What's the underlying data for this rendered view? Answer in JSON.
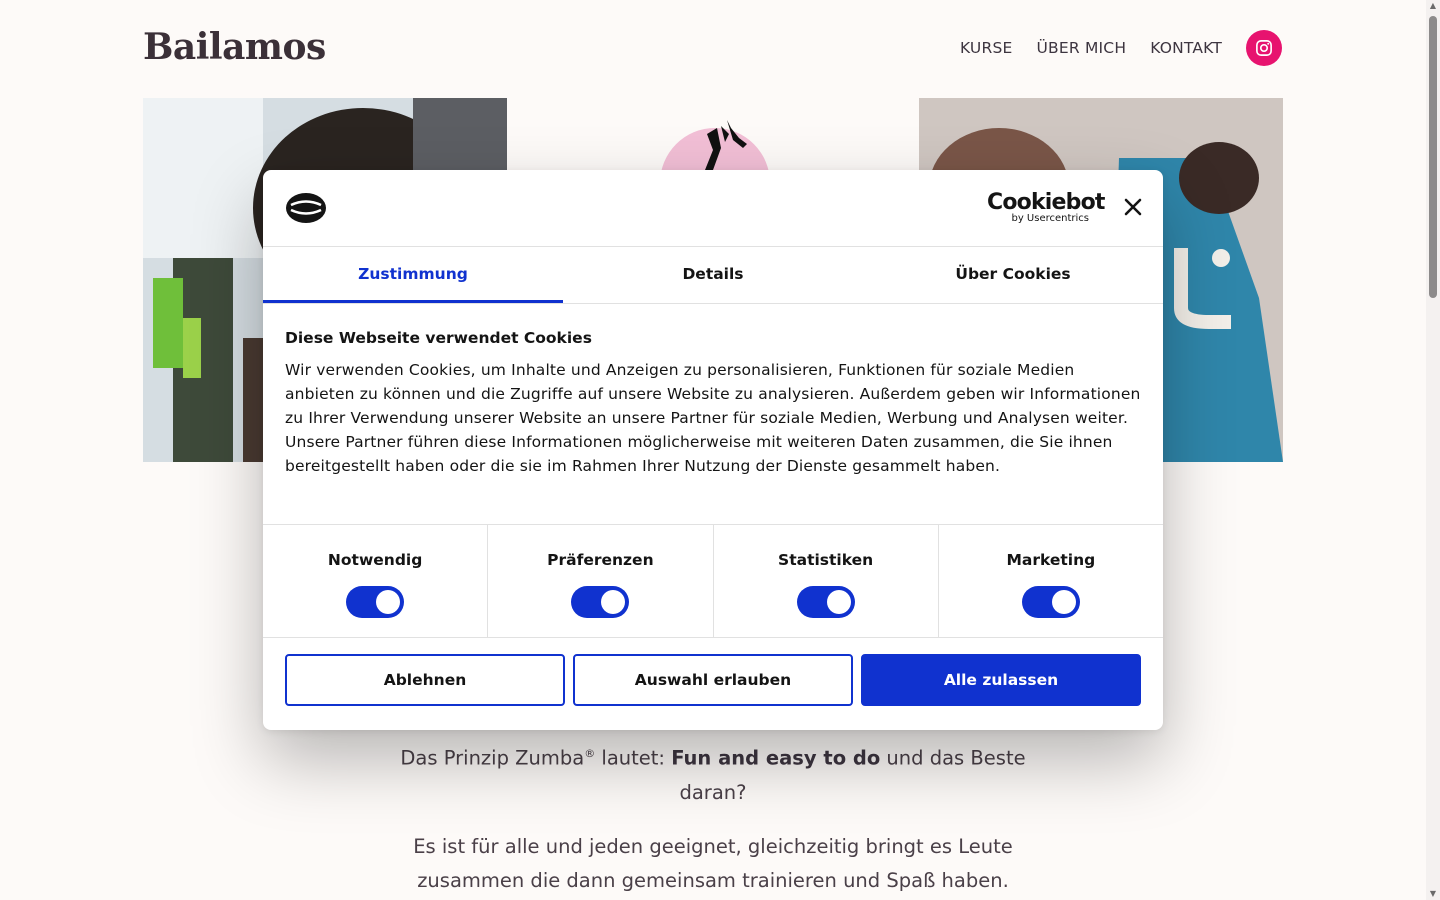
{
  "header": {
    "logo": "Bailamos",
    "nav": [
      "KURSE",
      "ÜBER MICH",
      "KONTAKT"
    ]
  },
  "body_text": {
    "p1_a": "Das Prinzip Zumba",
    "p1_reg": "®",
    "p1_b": " lautet: ",
    "p1_bold": "Fun and easy to do",
    "p1_c": " und das Beste daran?",
    "p2": "Es ist für alle und jeden geeignet, gleichzeitig bringt es Leute zusammen die dann gemeinsam trainieren und Spaß haben."
  },
  "cookie_dialog": {
    "brand_name": "Cookiebot",
    "brand_sub": "by Usercentrics",
    "tabs": [
      "Zustimmung",
      "Details",
      "Über Cookies"
    ],
    "title": "Diese Webseite verwendet Cookies",
    "text": "Wir verwenden Cookies, um Inhalte und Anzeigen zu personalisieren, Funktionen für soziale Medien anbieten zu können und die Zugriffe auf unsere Website zu analysieren. Außerdem geben wir Informationen zu Ihrer Verwendung unserer Website an unsere Partner für soziale Medien, Werbung und Analysen weiter. Unsere Partner führen diese Informationen möglicherweise mit weiteren Daten zusammen, die Sie ihnen bereitgestellt haben oder die sie im Rahmen Ihrer Nutzung der Dienste gesammelt haben.",
    "categories": [
      "Notwendig",
      "Präferenzen",
      "Statistiken",
      "Marketing"
    ],
    "buttons": {
      "reject": "Ablehnen",
      "allow_selection": "Auswahl erlauben",
      "allow_all": "Alle zulassen"
    }
  },
  "colors": {
    "accent": "#1032cf",
    "instagram": "#e7136f",
    "background": "#fdfaf8"
  }
}
